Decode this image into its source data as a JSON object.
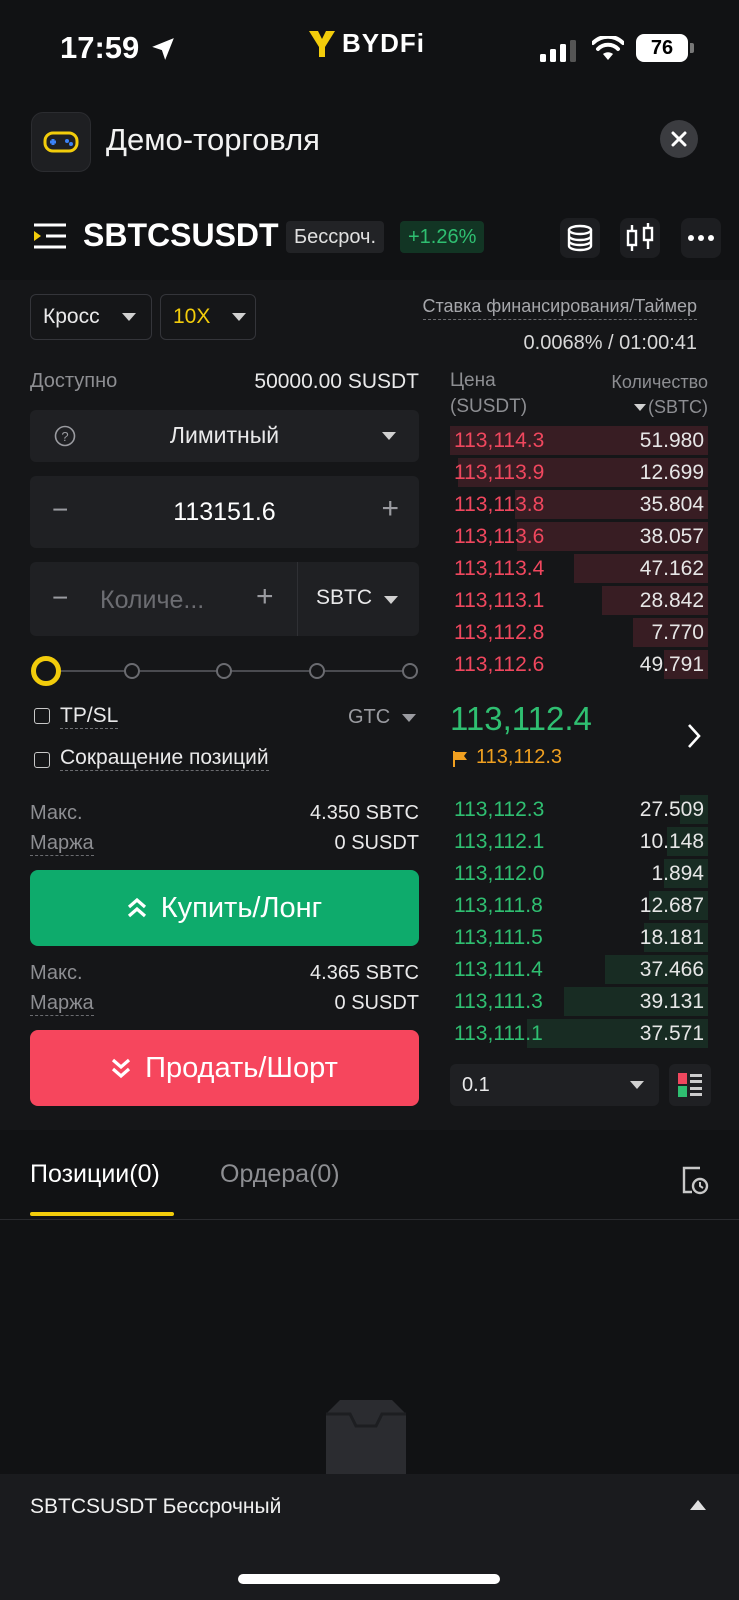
{
  "status_bar": {
    "time": "17:59",
    "battery": "76"
  },
  "brand": {
    "logo_text": "BYDFi",
    "accent": "#f2cc0b"
  },
  "demo_header": {
    "title": "Демо-торговля"
  },
  "pair_header": {
    "symbol": "SBTCSUSDT",
    "type_badge": "Бессроч.",
    "change": "+1.26%"
  },
  "order_form": {
    "margin_mode": "Кросс",
    "leverage": "10X",
    "available_label": "Доступно",
    "available_value": "50000.00 SUSDT",
    "order_type": "Лимитный",
    "price_value": "113151.6",
    "quantity_placeholder": "Количе...",
    "quantity_unit": "SBTC",
    "slider_percent": 0,
    "tpsl_label": "TP/SL",
    "tif": "GTC",
    "reduce_only_label": "Сокращение позиций",
    "buy": {
      "max_label": "Макс.",
      "max_value": "4.350 SBTC",
      "margin_label": "Маржа",
      "margin_value": "0 SUSDT",
      "button_label": "Купить/Лонг"
    },
    "sell": {
      "max_label": "Макс.",
      "max_value": "4.365 SBTC",
      "margin_label": "Маржа",
      "margin_value": "0 SUSDT",
      "button_label": "Продать/Шорт"
    }
  },
  "funding": {
    "label": "Ставка финансирования/Таймер",
    "value": "0.0068% / 01:00:41"
  },
  "orderbook": {
    "price_header_1": "Цена",
    "price_header_2": "(SUSDT)",
    "qty_header_1": "Количество",
    "qty_header_2": "(SBTC)",
    "asks": [
      {
        "price": "113,114.3",
        "qty": "51.980",
        "depth": 1.0
      },
      {
        "price": "113,113.9",
        "qty": "12.699",
        "depth": 0.97
      },
      {
        "price": "113,113.8",
        "qty": "35.804",
        "depth": 0.75
      },
      {
        "price": "113,113.6",
        "qty": "38.057",
        "depth": 0.74
      },
      {
        "price": "113,113.4",
        "qty": "47.162",
        "depth": 0.52
      },
      {
        "price": "113,113.1",
        "qty": "28.842",
        "depth": 0.41
      },
      {
        "price": "113,112.8",
        "qty": "7.770",
        "depth": 0.29
      },
      {
        "price": "113,112.6",
        "qty": "49.791",
        "depth": 0.17
      }
    ],
    "last_price": "113,112.4",
    "mark_price": "113,112.3",
    "bids": [
      {
        "price": "113,112.3",
        "qty": "27.509",
        "depth": 0.11
      },
      {
        "price": "113,112.1",
        "qty": "10.148",
        "depth": 0.16
      },
      {
        "price": "113,112.0",
        "qty": "1.894",
        "depth": 0.17
      },
      {
        "price": "113,111.8",
        "qty": "12.687",
        "depth": 0.23
      },
      {
        "price": "113,111.5",
        "qty": "18.181",
        "depth": 0.25
      },
      {
        "price": "113,111.4",
        "qty": "37.466",
        "depth": 0.4
      },
      {
        "price": "113,111.3",
        "qty": "39.131",
        "depth": 0.56
      },
      {
        "price": "113,111.1",
        "qty": "37.571",
        "depth": 0.7
      }
    ],
    "precision": "0.1"
  },
  "tabs": {
    "positions": "Позиции(0)",
    "orders": "Ордера(0)"
  },
  "bottom": {
    "label": "SBTCSUSDT Бессрочный"
  },
  "colors": {
    "ask": "#f0475e",
    "bid": "#2fbf71",
    "buy": "#0eab6c",
    "sell": "#f6465d"
  }
}
